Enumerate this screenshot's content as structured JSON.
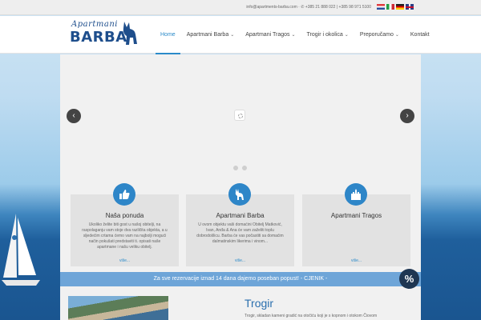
{
  "topbar": {
    "email": "info@apartments-barba.com",
    "phones": "+385 21 888 022 | +385 98 971 5100",
    "languages": [
      "hr",
      "it",
      "de",
      "en"
    ]
  },
  "logo": {
    "script": "Apartmani",
    "word": "BARBA"
  },
  "nav": {
    "items": [
      {
        "label": "Home",
        "active": true,
        "dropdown": false
      },
      {
        "label": "Apartmani Barba",
        "active": false,
        "dropdown": true
      },
      {
        "label": "Apartmani Tragos",
        "active": false,
        "dropdown": true
      },
      {
        "label": "Trogir i okolica",
        "active": false,
        "dropdown": true
      },
      {
        "label": "Preporučamo",
        "active": false,
        "dropdown": true
      },
      {
        "label": "Kontakt",
        "active": false,
        "dropdown": false
      }
    ]
  },
  "slider": {
    "prev": "‹",
    "next": "›",
    "slides": 2,
    "current": 1
  },
  "cards": [
    {
      "icon": "thumbs-up-icon",
      "title": "Naša ponuda",
      "text": "Ukoliko želite biti gost u našoj obitelji, na raspolaganju vam stoje dva različita objekta, a u sljedećim crtama ćemo vam na najbolji mogući način pokušati predstaviti ti. opisati naše apartmane i našu veliku obitelj.",
      "more": "više..."
    },
    {
      "icon": "donkey-icon",
      "title": "Apartmani Barba",
      "text": "U ovom objektu vaši domaćini Obitelj Matković, Ivan, Anđa & Ana će vam zaželiti toplu dobrodošlicu. Barba će vas počastiti sa domaćim dalmatinskim likerima i vinom...",
      "more": "više..."
    },
    {
      "icon": "castle-icon",
      "title": "Apartmani Tragos",
      "text": "",
      "more": "više..."
    }
  ],
  "promo": {
    "text": "Za sve rezervacije iznad 14 dana dajemo poseban popust! - CJENIK -",
    "badge": "%"
  },
  "trogir": {
    "title": "Trogir",
    "text": "Trogir, skladan kameni gradić na otočiću koji je s kopnom i otokom Čiovom"
  },
  "colors": {
    "accent": "#2a8ac9",
    "promo": "#6ea5d8",
    "icon_bg": "#2e86c8"
  }
}
